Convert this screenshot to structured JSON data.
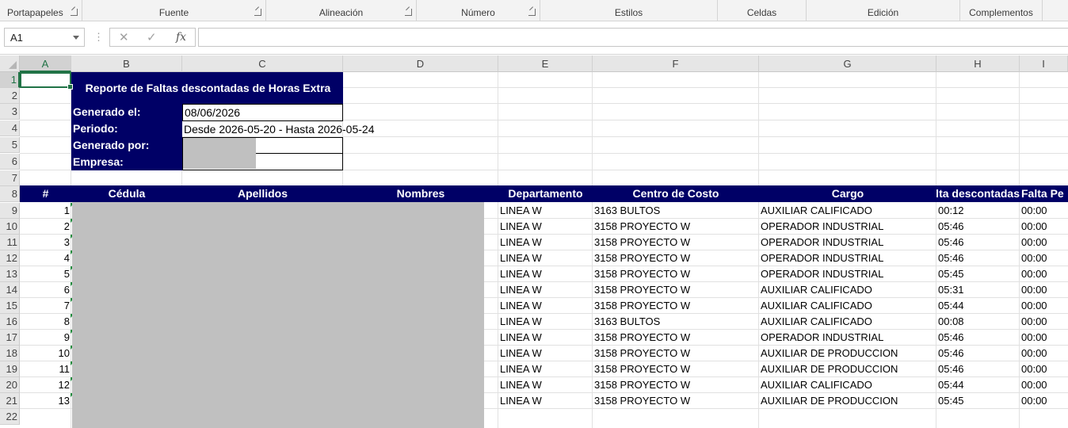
{
  "ribbon": {
    "groups": [
      "Portapapeles",
      "Fuente",
      "Alineación",
      "Número",
      "Estilos",
      "Celdas",
      "Edición",
      "Complementos"
    ]
  },
  "formula_bar": {
    "name_box": "A1",
    "cancel_icon": "✕",
    "enter_icon": "✓",
    "fx_label": "fx",
    "formula": ""
  },
  "sheet": {
    "columns": [
      "A",
      "B",
      "C",
      "D",
      "E",
      "F",
      "G",
      "H",
      "I"
    ],
    "rows": [
      "1",
      "2",
      "3",
      "4",
      "5",
      "6",
      "7",
      "8",
      "9",
      "10",
      "11",
      "12",
      "13",
      "14",
      "15",
      "16",
      "17",
      "18",
      "19",
      "20",
      "21",
      "22"
    ],
    "report_title": "Reporte de Faltas descontadas de Horas Extra",
    "info": {
      "generated_label": "Generado el:",
      "generated_value": "08/06/2026",
      "period_label": "Periodo:",
      "period_value": "Desde 2026-05-20 - Hasta 2026-05-24",
      "generated_by_label": "Generado por:",
      "company_label": "Empresa:"
    },
    "table": {
      "headers": [
        "#",
        "Cédula",
        "Apellidos",
        "Nombres",
        "Departamento",
        "Centro de Costo",
        "Cargo",
        "Horas de Falta descontadas",
        "Falta Pe"
      ],
      "rows": [
        {
          "n": "1",
          "dep": "LINEA W",
          "cc": "3163 BULTOS",
          "cargo": "AUXILIAR CALIFICADO",
          "h": "00:12",
          "i": "00:00"
        },
        {
          "n": "2",
          "dep": "LINEA W",
          "cc": "3158 PROYECTO W",
          "cargo": "OPERADOR INDUSTRIAL",
          "h": "05:46",
          "i": "00:00"
        },
        {
          "n": "3",
          "dep": "LINEA W",
          "cc": "3158 PROYECTO W",
          "cargo": "OPERADOR INDUSTRIAL",
          "h": "05:46",
          "i": "00:00"
        },
        {
          "n": "4",
          "dep": "LINEA W",
          "cc": "3158 PROYECTO W",
          "cargo": "OPERADOR INDUSTRIAL",
          "h": "05:46",
          "i": "00:00"
        },
        {
          "n": "5",
          "dep": "LINEA W",
          "cc": "3158 PROYECTO W",
          "cargo": "OPERADOR INDUSTRIAL",
          "h": "05:45",
          "i": "00:00"
        },
        {
          "n": "6",
          "dep": "LINEA W",
          "cc": "3158 PROYECTO W",
          "cargo": "AUXILIAR CALIFICADO",
          "h": "05:31",
          "i": "00:00"
        },
        {
          "n": "7",
          "dep": "LINEA W",
          "cc": "3158 PROYECTO W",
          "cargo": "AUXILIAR CALIFICADO",
          "h": "05:44",
          "i": "00:00"
        },
        {
          "n": "8",
          "dep": "LINEA W",
          "cc": "3163 BULTOS",
          "cargo": "AUXILIAR CALIFICADO",
          "h": "00:08",
          "i": "00:00"
        },
        {
          "n": "9",
          "dep": "LINEA W",
          "cc": "3158 PROYECTO W",
          "cargo": "OPERADOR INDUSTRIAL",
          "h": "05:46",
          "i": "00:00"
        },
        {
          "n": "10",
          "dep": "LINEA W",
          "cc": "3158 PROYECTO W",
          "cargo": "AUXILIAR DE PRODUCCION",
          "h": "05:46",
          "i": "00:00"
        },
        {
          "n": "11",
          "dep": "LINEA W",
          "cc": "3158 PROYECTO W",
          "cargo": "AUXILIAR DE PRODUCCION",
          "h": "05:46",
          "i": "00:00"
        },
        {
          "n": "12",
          "dep": "LINEA W",
          "cc": "3158 PROYECTO W",
          "cargo": "AUXILIAR CALIFICADO",
          "h": "05:44",
          "i": "00:00"
        },
        {
          "n": "13",
          "dep": "LINEA W",
          "cc": "3158 PROYECTO W",
          "cargo": "AUXILIAR DE PRODUCCION",
          "h": "05:45",
          "i": "00:00"
        }
      ]
    }
  },
  "colors": {
    "header_navy": "#000066",
    "excel_green": "#217346",
    "redaction_gray": "#c0c0c0"
  }
}
